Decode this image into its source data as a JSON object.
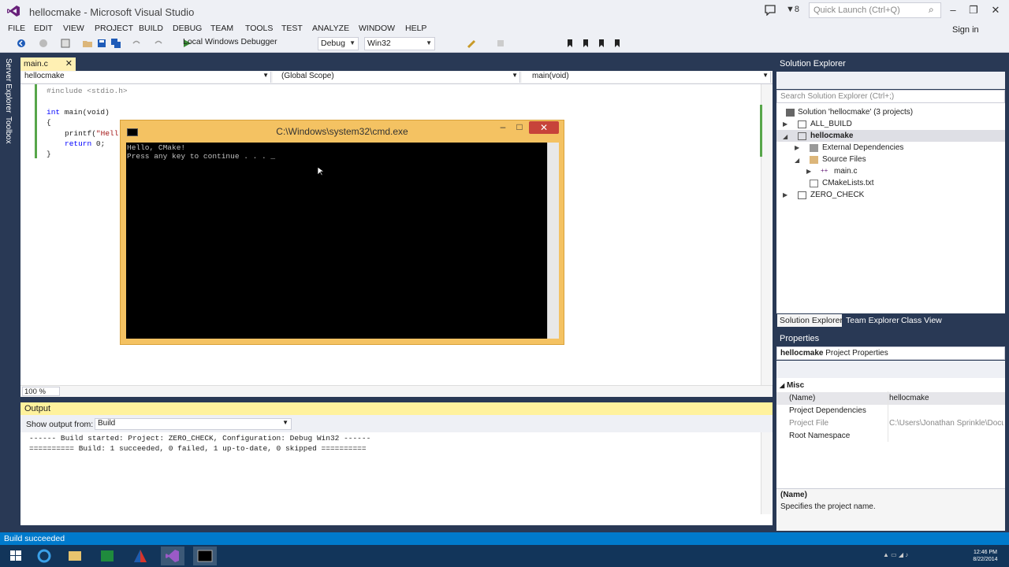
{
  "window": {
    "title": "hellocmake - Microsoft Visual Studio",
    "filter_count": "8",
    "quick_launch_placeholder": "Quick Launch (Ctrl+Q)",
    "signin": "Sign in"
  },
  "menu": [
    "FILE",
    "EDIT",
    "VIEW",
    "PROJECT",
    "BUILD",
    "DEBUG",
    "TEAM",
    "TOOLS",
    "TEST",
    "ANALYZE",
    "WINDOW",
    "HELP"
  ],
  "toolbar": {
    "debugger_label": "Local Windows Debugger",
    "config": "Debug",
    "platform": "Win32"
  },
  "left_tabs": [
    "Server Explorer",
    "Toolbox"
  ],
  "editor": {
    "tab_label": "main.c",
    "nav_project": "hellocmake",
    "nav_scope": "(Global Scope)",
    "nav_function": "main(void)",
    "zoom": "100 %",
    "lines": {
      "l1_pp": "#include <stdio.h>",
      "l3_kw": "int",
      "l3_rest": " main(void)",
      "l4": "{",
      "l5_fn": "printf(",
      "l5_str": "\"Hell",
      "l6_kw": "return",
      "l6_rest": " 0;",
      "l7": "}"
    }
  },
  "cmd": {
    "title": "C:\\Windows\\system32\\cmd.exe",
    "line1": "Hello, CMake!",
    "line2": "Press any key to continue . . . _"
  },
  "output": {
    "title": "Output",
    "show_from_label": "Show output from:",
    "source": "Build",
    "line1": "------ Build started: Project: ZERO_CHECK, Configuration: Debug Win32 ------",
    "line2": "========== Build: 1 succeeded, 0 failed, 1 up-to-date, 0 skipped =========="
  },
  "solution_explorer": {
    "title": "Solution Explorer",
    "search_placeholder": "Search Solution Explorer (Ctrl+;)",
    "items": {
      "solution": "Solution 'hellocmake' (3 projects)",
      "all_build": "ALL_BUILD",
      "hellocmake": "hellocmake",
      "external_deps": "External Dependencies",
      "source_files": "Source Files",
      "main_c": "main.c",
      "cmakelists": "CMakeLists.txt",
      "zero_check": "ZERO_CHECK"
    },
    "tabs": [
      "Solution Explorer",
      "Team Explorer",
      "Class View"
    ]
  },
  "properties": {
    "title": "Properties",
    "object_name": "hellocmake",
    "object_type": "Project Properties",
    "category": "Misc",
    "rows": [
      {
        "name": "(Name)",
        "value": "hellocmake"
      },
      {
        "name": "Project Dependencies",
        "value": ""
      },
      {
        "name": "Project File",
        "value": "C:\\Users\\Jonathan Sprinkle\\Docu"
      },
      {
        "name": "Root Namespace",
        "value": ""
      }
    ],
    "desc_title": "(Name)",
    "desc_text": "Specifies the project name."
  },
  "status": {
    "text": "Build succeeded"
  },
  "taskbar": {
    "time": "12:46 PM",
    "date": "8/22/2014"
  },
  "colors": {
    "vs_purple": "#68217a",
    "status_blue": "#007acc",
    "output_header": "#fff29d",
    "cmd_frame": "#f4c262"
  }
}
